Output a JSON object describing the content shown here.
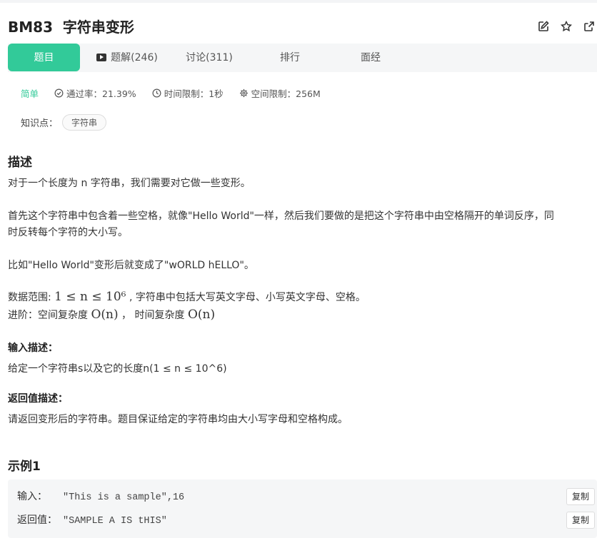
{
  "problem": {
    "title": "BM83  字符串变形"
  },
  "tabs": [
    {
      "label": "题目"
    },
    {
      "label": "题解(246)"
    },
    {
      "label": "讨论(311)"
    },
    {
      "label": "排行"
    },
    {
      "label": "面经"
    }
  ],
  "meta": {
    "difficulty": "简单",
    "pass_rate": "通过率：21.39%",
    "time_limit": "时间限制：1秒",
    "space_limit": "空间限制：256M"
  },
  "knowledge": {
    "label": "知识点：",
    "tag": "字符串"
  },
  "description": {
    "heading": "描述",
    "p1": "对于一个长度为 n 字符串，我们需要对它做一些变形。",
    "p2_line1": "首先这个字符串中包含着一些空格，就像\"Hello World\"一样，然后我们要做的是把这个字符串中由空格隔开的单词反序，同",
    "p2_line2": "时反转每个字符的大小写。",
    "p3": "比如\"Hello World\"变形后就变成了\"wORLD hELLO\"。",
    "range_prefix": "数据范围: ",
    "range_math": "1 ≤ n ≤ 10⁶",
    "range_suffix": " , 字符串中包括大写英文字母、小写英文字母、空格。",
    "adv_prefix": "进阶：空间复杂度 ",
    "adv_math1": "O(n)",
    "adv_mid": " ，  时间复杂度 ",
    "adv_math2": "O(n)"
  },
  "input": {
    "heading": "输入描述：",
    "text": "给定一个字符串s以及它的长度n(1 ≤ n ≤ 10^6)"
  },
  "output": {
    "heading": "返回值描述：",
    "text": "请返回变形后的字符串。题目保证给定的字符串均由大小写字母和空格构成。"
  },
  "example": {
    "heading": "示例1",
    "input_label": "输入：",
    "input_value": "\"This is a sample\",16",
    "output_label": "返回值：",
    "output_value": "\"SAMPLE A IS tHIS\"",
    "copy_label": "复制"
  },
  "colors": {
    "accent": "#32ca99",
    "tab_bg": "#f5f6f7"
  }
}
